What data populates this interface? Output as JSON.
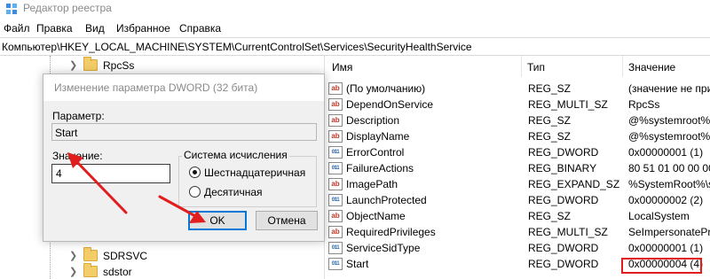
{
  "window": {
    "title": "Редактор реестра",
    "icon": "registry-editor-icon"
  },
  "menu": [
    "Файл",
    "Правка",
    "Вид",
    "Избранное",
    "Справка"
  ],
  "address": "Компьютер\\HKEY_LOCAL_MACHINE\\SYSTEM\\CurrentControlSet\\Services\\SecurityHealthService",
  "tree": {
    "items": [
      "RpcSs",
      "SDRSVC",
      "sdstor"
    ]
  },
  "list": {
    "columns": [
      "Имя",
      "Тип",
      "Значение"
    ],
    "rows": [
      {
        "name": "(По умолчанию)",
        "type": "REG_SZ",
        "value": "(значение не при",
        "icon": "string-value-icon"
      },
      {
        "name": "DependOnService",
        "type": "REG_MULTI_SZ",
        "value": "RpcSs",
        "icon": "string-value-icon"
      },
      {
        "name": "Description",
        "type": "REG_SZ",
        "value": "@%systemroot%\\",
        "icon": "string-value-icon"
      },
      {
        "name": "DisplayName",
        "type": "REG_SZ",
        "value": "@%systemroot%\\",
        "icon": "string-value-icon"
      },
      {
        "name": "ErrorControl",
        "type": "REG_DWORD",
        "value": "0x00000001 (1)",
        "icon": "binary-value-icon"
      },
      {
        "name": "FailureActions",
        "type": "REG_BINARY",
        "value": "80 51 01 00 00 00 0",
        "icon": "binary-value-icon"
      },
      {
        "name": "ImagePath",
        "type": "REG_EXPAND_SZ",
        "value": "%SystemRoot%\\sy",
        "icon": "string-value-icon"
      },
      {
        "name": "LaunchProtected",
        "type": "REG_DWORD",
        "value": "0x00000002 (2)",
        "icon": "binary-value-icon"
      },
      {
        "name": "ObjectName",
        "type": "REG_SZ",
        "value": "LocalSystem",
        "icon": "string-value-icon"
      },
      {
        "name": "RequiredPrivileges",
        "type": "REG_MULTI_SZ",
        "value": "SeImpersonatePriv",
        "icon": "string-value-icon"
      },
      {
        "name": "ServiceSidType",
        "type": "REG_DWORD",
        "value": "0x00000001 (1)",
        "icon": "binary-value-icon"
      },
      {
        "name": "Start",
        "type": "REG_DWORD",
        "value": "0x00000004 (4)",
        "icon": "binary-value-icon"
      }
    ]
  },
  "dialog": {
    "title": "Изменение параметра DWORD (32 бита)",
    "param_label": "Параметр:",
    "param_value": "Start",
    "value_label": "Значение:",
    "value": "4",
    "base_label": "Система исчисления",
    "hex_label": "Шестнадцатеричная",
    "dec_label": "Десятичная",
    "ok_label": "OK",
    "cancel_label": "Отмена"
  },
  "colors": {
    "highlight": "#e11d1d",
    "focus": "#0078d7"
  }
}
